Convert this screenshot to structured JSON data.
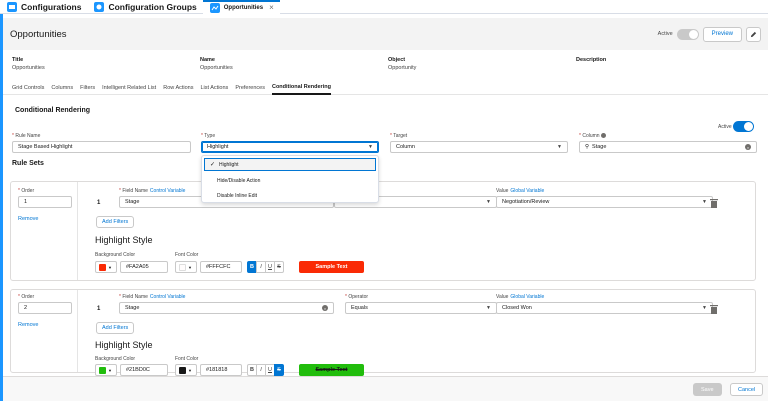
{
  "tabs": [
    {
      "label": "Configurations"
    },
    {
      "label": "Configuration Groups"
    },
    {
      "label": "Opportunities",
      "close": "×"
    }
  ],
  "header": {
    "title": "Opportunities",
    "active_label": "Active",
    "preview_label": "Preview"
  },
  "details": {
    "title_label": "Title",
    "title_value": "Opportunities",
    "name_label": "Name",
    "name_value": "Opportunities",
    "object_label": "Object",
    "object_value": "Opportunity",
    "description_label": "Description"
  },
  "subtabs": [
    "Grid Controls",
    "Columns",
    "Filters",
    "Intelligent Related List",
    "Row Actions",
    "List Actions",
    "Preferences",
    "Conditional Rendering"
  ],
  "conditional": {
    "section_title": "Conditional Rendering",
    "rule_name_label": "Rule Name",
    "rule_name_value": "Stage Based Highlight",
    "type_label": "Type",
    "type_value": "Highlight",
    "target_label": "Target",
    "target_value": "Column",
    "column_label": "Column",
    "column_value": "Stage",
    "active_label": "Active",
    "rule_sets_title": "Rule Sets",
    "required_mark": "*",
    "type_options": [
      "Highlight",
      "Hide/Disable Action",
      "Disable Inline Edit"
    ],
    "checkmark": "✓"
  },
  "rules": [
    {
      "order_label": "Order",
      "order_value": "1",
      "remove": "Remove",
      "index": "1",
      "field_label": "Field Name",
      "field_link": "Control Variable",
      "field_value": "Stage",
      "operator_label": "Operator",
      "operator_value": "",
      "value_label": "Value",
      "value_link": "Global Variable",
      "value_value": "Negotiation/Review",
      "add_filters": "Add Filters",
      "hl_title": "Highlight Style",
      "bg_label": "Background Color",
      "bg_value": "#FA2A05",
      "bg_color": "#FA2A05",
      "font_label": "Font Color",
      "font_value": "#FFFCFC",
      "font_color": "#FFFCFC",
      "format_buttons": [
        "B",
        "I",
        "U",
        "S"
      ],
      "sample": "Sample Text"
    },
    {
      "order_label": "Order",
      "order_value": "2",
      "remove": "Remove",
      "index": "1",
      "field_label": "Field Name",
      "field_link": "Control Variable",
      "field_value": "Stage",
      "operator_label": "Operator",
      "operator_value": "Equals",
      "value_label": "Value",
      "value_link": "Global Variable",
      "value_value": "Closed Won",
      "add_filters": "Add Filters",
      "hl_title": "Highlight Style",
      "bg_label": "Background Color",
      "bg_value": "#21BD0C",
      "bg_color": "#21BD0C",
      "font_label": "Font Color",
      "font_value": "#181818",
      "font_color": "#181818",
      "format_buttons": [
        "B",
        "I",
        "U",
        "S"
      ],
      "sample": "Sample Text"
    }
  ],
  "footer": {
    "save": "Save",
    "cancel": "Cancel"
  },
  "colors": {
    "accent": "#0176d3",
    "tab_icon": "#1b96ff"
  }
}
